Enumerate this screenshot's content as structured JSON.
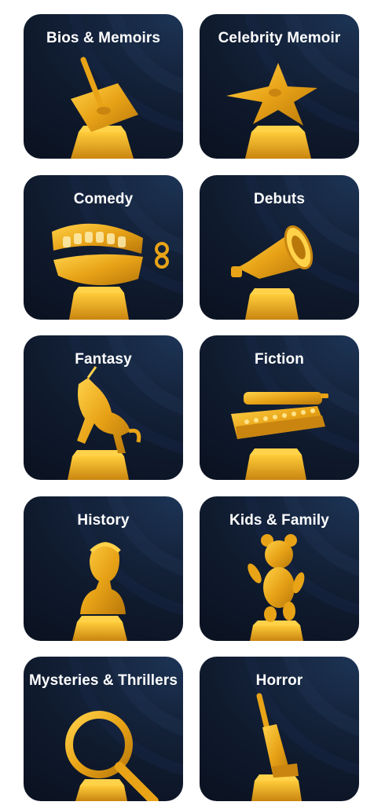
{
  "colors": {
    "card_bg": "#0f1a2d",
    "gold": "#e8a317",
    "gold_light": "#ffd24a",
    "gold_dark": "#b8780a",
    "title_text": "#ffffff"
  },
  "categories": [
    {
      "label": "Bios & Memoirs",
      "icon": "pen-nib-trophy-icon"
    },
    {
      "label": "Celebrity Memoir",
      "icon": "star-trophy-icon"
    },
    {
      "label": "Comedy",
      "icon": "wind-up-teeth-trophy-icon"
    },
    {
      "label": "Debuts",
      "icon": "megaphone-trophy-icon"
    },
    {
      "label": "Fantasy",
      "icon": "unicorn-trophy-icon"
    },
    {
      "label": "Fiction",
      "icon": "typewriter-trophy-icon"
    },
    {
      "label": "History",
      "icon": "bust-trophy-icon"
    },
    {
      "label": "Kids & Family",
      "icon": "teddy-bear-trophy-icon"
    },
    {
      "label": "Mysteries & Thrillers",
      "icon": "magnifying-glass-trophy-icon"
    },
    {
      "label": "Horror",
      "icon": "cleaver-trophy-icon"
    }
  ]
}
